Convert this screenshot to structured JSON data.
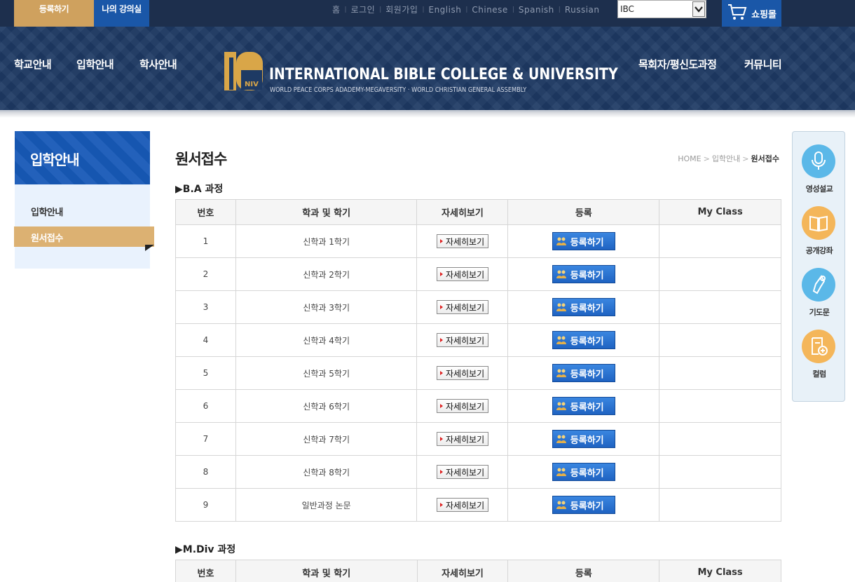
{
  "topbar": {
    "register_label": "등록하기",
    "myclass_label": "나의 강의실",
    "links": [
      "홈",
      "로그인",
      "회원가입",
      "English",
      "Chinese",
      "Spanish",
      "Russian"
    ],
    "site_select_value": "IBC",
    "shop_label": "쇼핑몰"
  },
  "header": {
    "nav_left": [
      "학교안내",
      "입학안내",
      "학사안내"
    ],
    "nav_right": [
      "목회자/평신도과정",
      "커뮤니티"
    ],
    "brand_title": "INTERNATIONAL BIBLE COLLEGE & UNIVERSITY",
    "brand_subtitle": "WORLD PEACE CORPS ADADEMY-MEGAVERSITY · WORLD CHRISTIAN GENERAL ASSEMBLY",
    "logo_text": "IB",
    "logo_small": "NIV"
  },
  "sidebar": {
    "title": "입학안내",
    "items": [
      "입학안내",
      "원서접수"
    ]
  },
  "content": {
    "page_title": "원서접수",
    "breadcrumb": [
      "HOME",
      "입학안내",
      "원서접수"
    ],
    "sections": [
      {
        "title": "▶B.A 과정",
        "headers": [
          "번호",
          "학과 및 학기",
          "자세히보기",
          "등록",
          "My Class"
        ],
        "rows": [
          {
            "no": "1",
            "name": "신학과 1학기"
          },
          {
            "no": "2",
            "name": "신학과 2학기"
          },
          {
            "no": "3",
            "name": "신학과 3학기"
          },
          {
            "no": "4",
            "name": "신학과 4학기"
          },
          {
            "no": "5",
            "name": "신학과 5학기"
          },
          {
            "no": "6",
            "name": "신학과 6학기"
          },
          {
            "no": "7",
            "name": "신학과 7학기"
          },
          {
            "no": "8",
            "name": "신학과 8학기"
          },
          {
            "no": "9",
            "name": "일반과정 논문"
          }
        ]
      },
      {
        "title": "▶M.Div 과정",
        "headers": [
          "번호",
          "학과 및 학기",
          "자세히보기",
          "등록",
          "My Class"
        ],
        "rows": []
      }
    ],
    "detail_label": "자세히보기",
    "register_label": "등록하기"
  },
  "quickmenu": {
    "items": [
      {
        "label": "영성설교",
        "icon": "microphone-icon",
        "color": "#5bb8e8"
      },
      {
        "label": "공개강좌",
        "icon": "book-icon",
        "color": "#f4b65a"
      },
      {
        "label": "기도문",
        "icon": "praying-hands-icon",
        "color": "#5bb8e8"
      },
      {
        "label": "컬럼",
        "icon": "document-add-icon",
        "color": "#f4b65a"
      }
    ]
  },
  "colors": {
    "topbar": "#1d2f4d",
    "header": "#1e3a64",
    "accent_gold": "#cfa15e",
    "accent_blue": "#1a57a8"
  }
}
